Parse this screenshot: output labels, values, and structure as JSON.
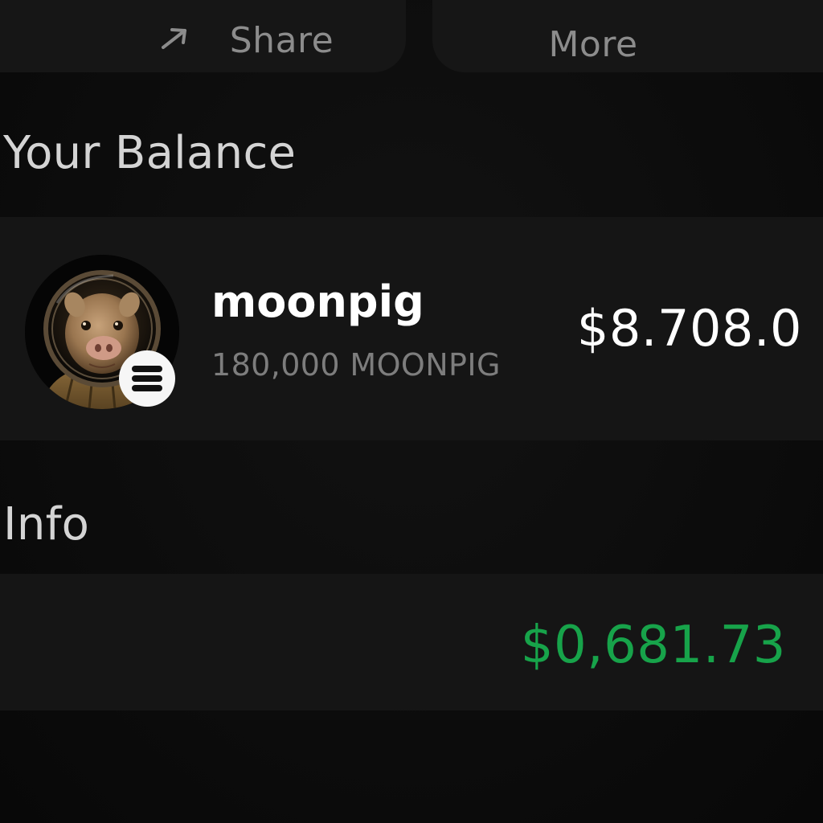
{
  "actions": {
    "share_label": "Share",
    "share_icon": "share-arrow-icon",
    "more_label": "More"
  },
  "balance": {
    "title": "Your Balance",
    "token": {
      "name": "moonpig",
      "amount": "180,000 MOONPIG",
      "value": "$8.708.0",
      "avatar_icon": "astronaut-pig-avatar",
      "chain_icon": "solana-chain-icon"
    }
  },
  "info": {
    "title": "Info",
    "value": "$0,681.73"
  },
  "colors": {
    "background": "#0c0c0c",
    "card": "#151515",
    "positive": "#17a34a",
    "muted_text": "#7d7d7d"
  }
}
